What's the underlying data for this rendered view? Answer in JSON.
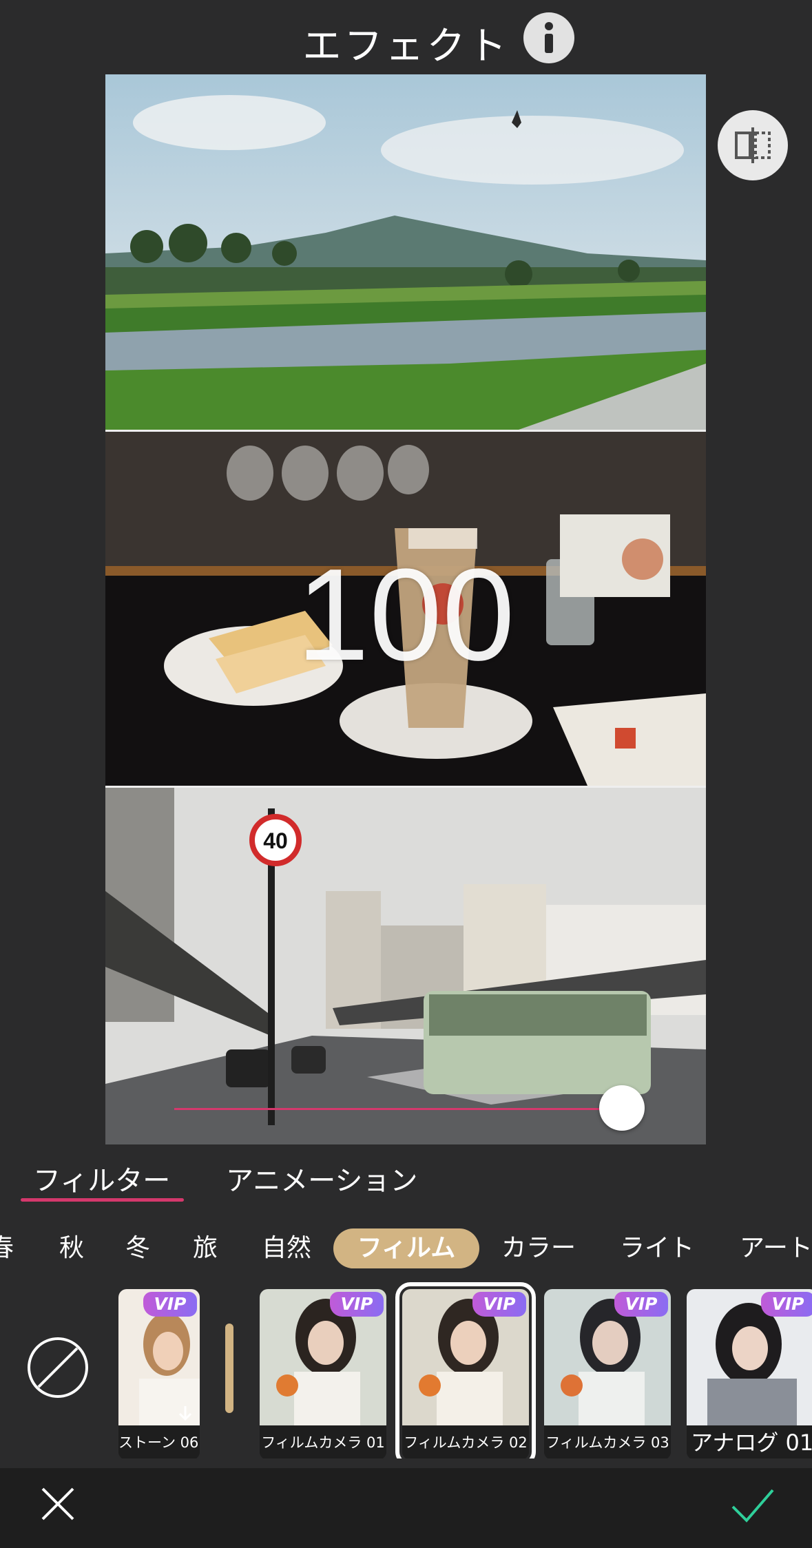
{
  "header": {
    "title": "エフェクト",
    "info_icon": "info-icon"
  },
  "preview": {
    "intensity": "100",
    "slider_value": 1.0,
    "compare_icon": "split-compare-icon",
    "images": [
      "river-landscape-photo",
      "cafe-table-photo",
      "city-street-photo"
    ],
    "speed_sign_text": "40"
  },
  "tabs": [
    {
      "label": "フィルター",
      "active": true
    },
    {
      "label": "アニメーション",
      "active": false
    }
  ],
  "categories": [
    {
      "label": "春"
    },
    {
      "label": "秋"
    },
    {
      "label": "冬"
    },
    {
      "label": "旅"
    },
    {
      "label": "自然"
    },
    {
      "label": "フィルム",
      "active": true
    },
    {
      "label": "カラー"
    },
    {
      "label": "ライト"
    },
    {
      "label": "アート"
    }
  ],
  "filters": [
    {
      "label": "ストーン 06",
      "vip": true,
      "download": true
    },
    {
      "label": "フィルムカメラ 01",
      "vip": true
    },
    {
      "label": "フィルムカメラ 02",
      "vip": true,
      "selected": true
    },
    {
      "label": "フィルムカメラ 03",
      "vip": true
    },
    {
      "label": "アナログ 01",
      "vip": true
    }
  ],
  "vip_text": "VIP",
  "colors": {
    "accent": "#d4386c",
    "category_active": "#d2b483",
    "confirm": "#2fcf9a",
    "background": "#2b2b2c"
  },
  "bottom_bar": {
    "cancel_icon": "close-icon",
    "confirm_icon": "check-icon"
  }
}
